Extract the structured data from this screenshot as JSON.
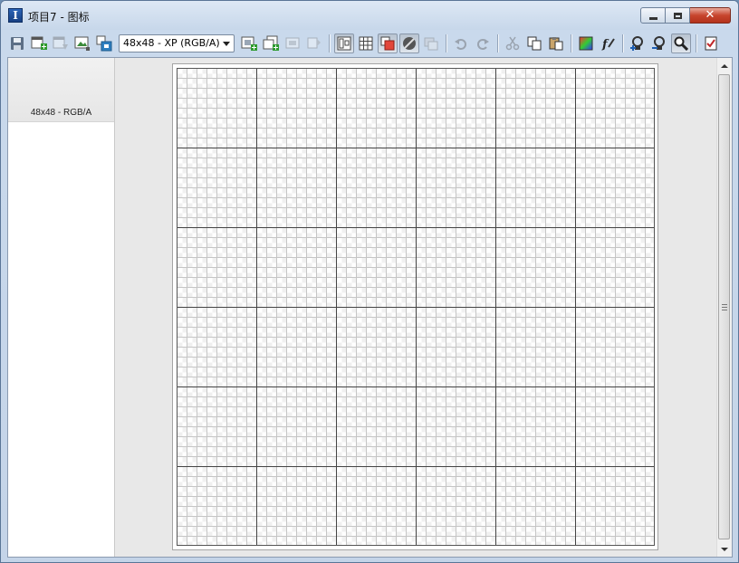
{
  "window": {
    "app_icon_glyph": "I",
    "title": "项目7 - 图标",
    "min_icon": "minimize-icon",
    "max_icon": "maximize-icon",
    "close_icon": "close-icon",
    "close_glyph": "✕"
  },
  "toolbar": {
    "format_combo": {
      "value": "48x48 - XP (RGB/A)"
    },
    "buttons": [
      {
        "name": "save-icon"
      },
      {
        "name": "new-image-icon"
      },
      {
        "name": "delete-image-icon",
        "disabled": true
      },
      {
        "name": "import-image-icon"
      },
      {
        "name": "export-image-icon"
      },
      {
        "name": "add-format-icon"
      },
      {
        "name": "add-multiple-formats-icon"
      },
      {
        "name": "remove-format-icon",
        "disabled": true
      },
      {
        "name": "format-properties-icon",
        "disabled": true
      },
      {
        "name": "view-preview-icon",
        "pressed": true
      },
      {
        "name": "pixel-grid-icon"
      },
      {
        "name": "background-color-icon",
        "pressed": true
      },
      {
        "name": "transparency-icon",
        "pressed": true
      },
      {
        "name": "mask-icon",
        "disabled": true
      },
      {
        "name": "undo-icon",
        "disabled": true
      },
      {
        "name": "redo-icon",
        "disabled": true
      },
      {
        "name": "cut-icon",
        "disabled": true
      },
      {
        "name": "copy-icon"
      },
      {
        "name": "paste-icon"
      },
      {
        "name": "color-palette-icon"
      },
      {
        "name": "filter-icon"
      },
      {
        "name": "zoom-in-icon"
      },
      {
        "name": "zoom-out-icon"
      },
      {
        "name": "zoom-tool-icon",
        "pressed": true
      },
      {
        "name": "test-icon-check"
      }
    ]
  },
  "formats_panel": {
    "items": [
      {
        "label": "48x48 - RGB/A",
        "selected": true
      }
    ]
  },
  "colors": {
    "accent_close": "#c7452e",
    "titlebar": "#dde8f5"
  }
}
